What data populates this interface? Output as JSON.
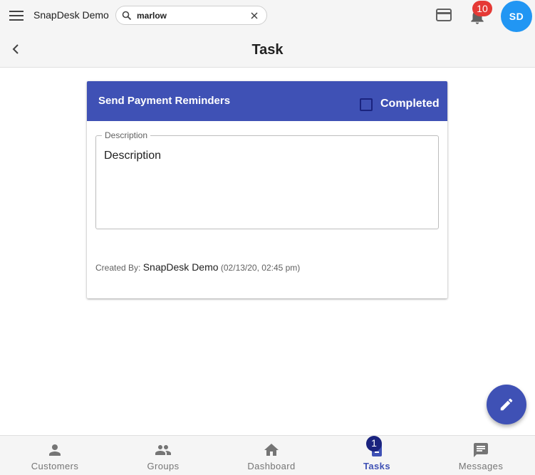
{
  "header": {
    "app_title": "SnapDesk Demo",
    "search": {
      "value": "marlow"
    },
    "notifications_count": "10",
    "avatar_initials": "SD",
    "page_title": "Task"
  },
  "task": {
    "title": "Send Payment Reminders",
    "completed_label": "Completed",
    "completed": false,
    "description_label": "Description",
    "description_value": "Description",
    "created_by_label": "Created By:",
    "created_by_name": "SnapDesk Demo",
    "created_at": "(02/13/20, 02:45 pm)"
  },
  "bottom_nav": {
    "items": [
      {
        "label": "Customers",
        "icon": "person-icon"
      },
      {
        "label": "Groups",
        "icon": "group-icon"
      },
      {
        "label": "Dashboard",
        "icon": "home-icon"
      },
      {
        "label": "Tasks",
        "icon": "task-icon",
        "active": true,
        "badge": "1"
      },
      {
        "label": "Messages",
        "icon": "message-icon"
      }
    ]
  },
  "colors": {
    "primary": "#3f51b5",
    "accent_blue": "#2196f3",
    "badge_red": "#e53935"
  }
}
